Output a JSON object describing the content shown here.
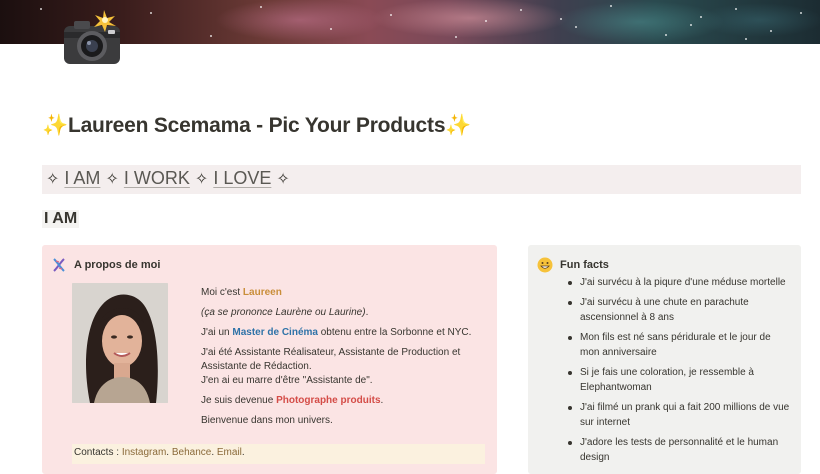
{
  "page": {
    "title_sparkle_left": "✨",
    "title": "Laureen Scemama - Pic Your Products",
    "title_sparkle_right": "✨"
  },
  "nav": {
    "separator": "✧",
    "items": [
      "I AM",
      "I WORK",
      "I LOVE"
    ]
  },
  "section": {
    "heading": "I AM"
  },
  "about": {
    "title": "A propos de moi",
    "lines": {
      "hello_prefix": "Moi c'est ",
      "hello_name": "Laureen",
      "pronounce": "(ça se prononce Laurène ou Laurine)",
      "pronounce_suffix": ".",
      "master_prefix": "J'ai un ",
      "master_link": "Master de Cinéma",
      "master_suffix": " obtenu entre la Sorbonne et NYC.",
      "assistant_1": "J'ai été Assistante Réalisateur, Assistante de Production et Assistante de Rédaction.",
      "assistant_2": "J'en ai eu marre d'être \"Assistante de\".",
      "became_prefix": "Je suis devenue ",
      "became_link": "Photographe produits",
      "became_suffix": ".",
      "welcome": "Bienvenue dans mon univers."
    },
    "contacts": {
      "label": "Contacts : ",
      "instagram": "Instagram",
      "behance": "Behance",
      "email": "Email",
      "sep": ". ",
      "end": "."
    }
  },
  "facts": {
    "title": "Fun facts",
    "items": [
      "J'ai survécu à la piqure d'une méduse mortelle",
      "J'ai survécu à une chute en parachute ascensionnel à 8 ans",
      "Mon fils est né sans péridurale et le jour de mon anniversaire",
      "Si je fais une coloration, je ressemble à Elephantwoman",
      "J'ai filmé un prank qui a fait 200 millions de vue sur internet",
      "J'adore les tests de personnalité et le human design"
    ]
  },
  "icons": {
    "page": "camera-flash-icon",
    "about": "dna-icon",
    "facts": "grinning-face-icon"
  }
}
